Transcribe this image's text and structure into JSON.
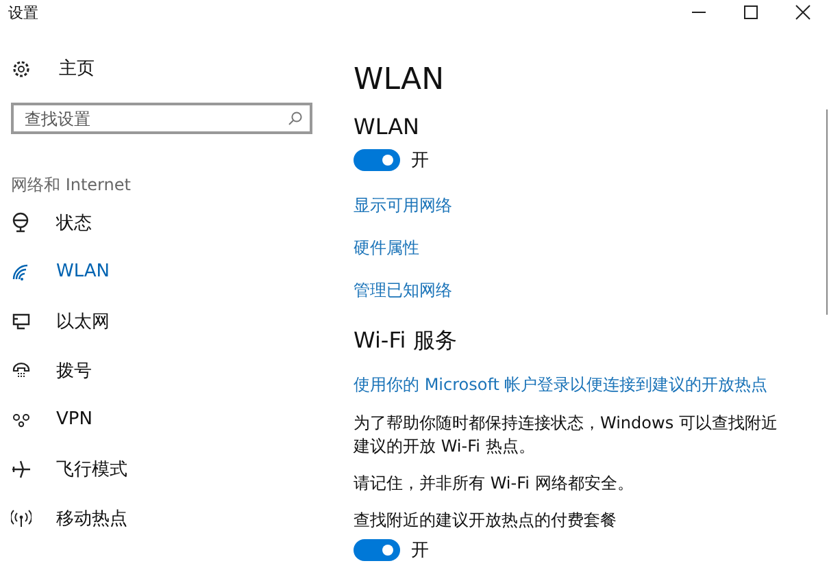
{
  "window": {
    "title": "设置"
  },
  "sidebar": {
    "home": "主页",
    "search": {
      "placeholder": "查找设置"
    },
    "section": "网络和 Internet",
    "items": [
      {
        "label": "状态",
        "kind": "status",
        "selected": false
      },
      {
        "label": "WLAN",
        "kind": "wlan",
        "selected": true
      },
      {
        "label": "以太网",
        "kind": "ethernet",
        "selected": false
      },
      {
        "label": "拨号",
        "kind": "dialup",
        "selected": false
      },
      {
        "label": "VPN",
        "kind": "vpn",
        "selected": false
      },
      {
        "label": "飞行模式",
        "kind": "airplane",
        "selected": false
      },
      {
        "label": "移动热点",
        "kind": "hotspot",
        "selected": false
      }
    ]
  },
  "content": {
    "title": "WLAN",
    "wlan": {
      "heading": "WLAN",
      "toggle": {
        "on": true,
        "label": "开"
      }
    },
    "links": [
      "显示可用网络",
      "硬件属性",
      "管理已知网络"
    ],
    "wifi_services": {
      "heading": "Wi-Fi 服务",
      "link": "使用你的 Microsoft 帐户登录以便连接到建议的开放热点",
      "paragraphs": [
        "为了帮助你随时都保持连接状态，Windows 可以查找附近建议的开放 Wi-Fi 热点。",
        "请记住，并非所有 Wi-Fi 网络都安全。"
      ],
      "paid_label": "查找附近的建议开放热点的付费套餐",
      "toggle": {
        "on": true,
        "label": "开"
      }
    }
  }
}
